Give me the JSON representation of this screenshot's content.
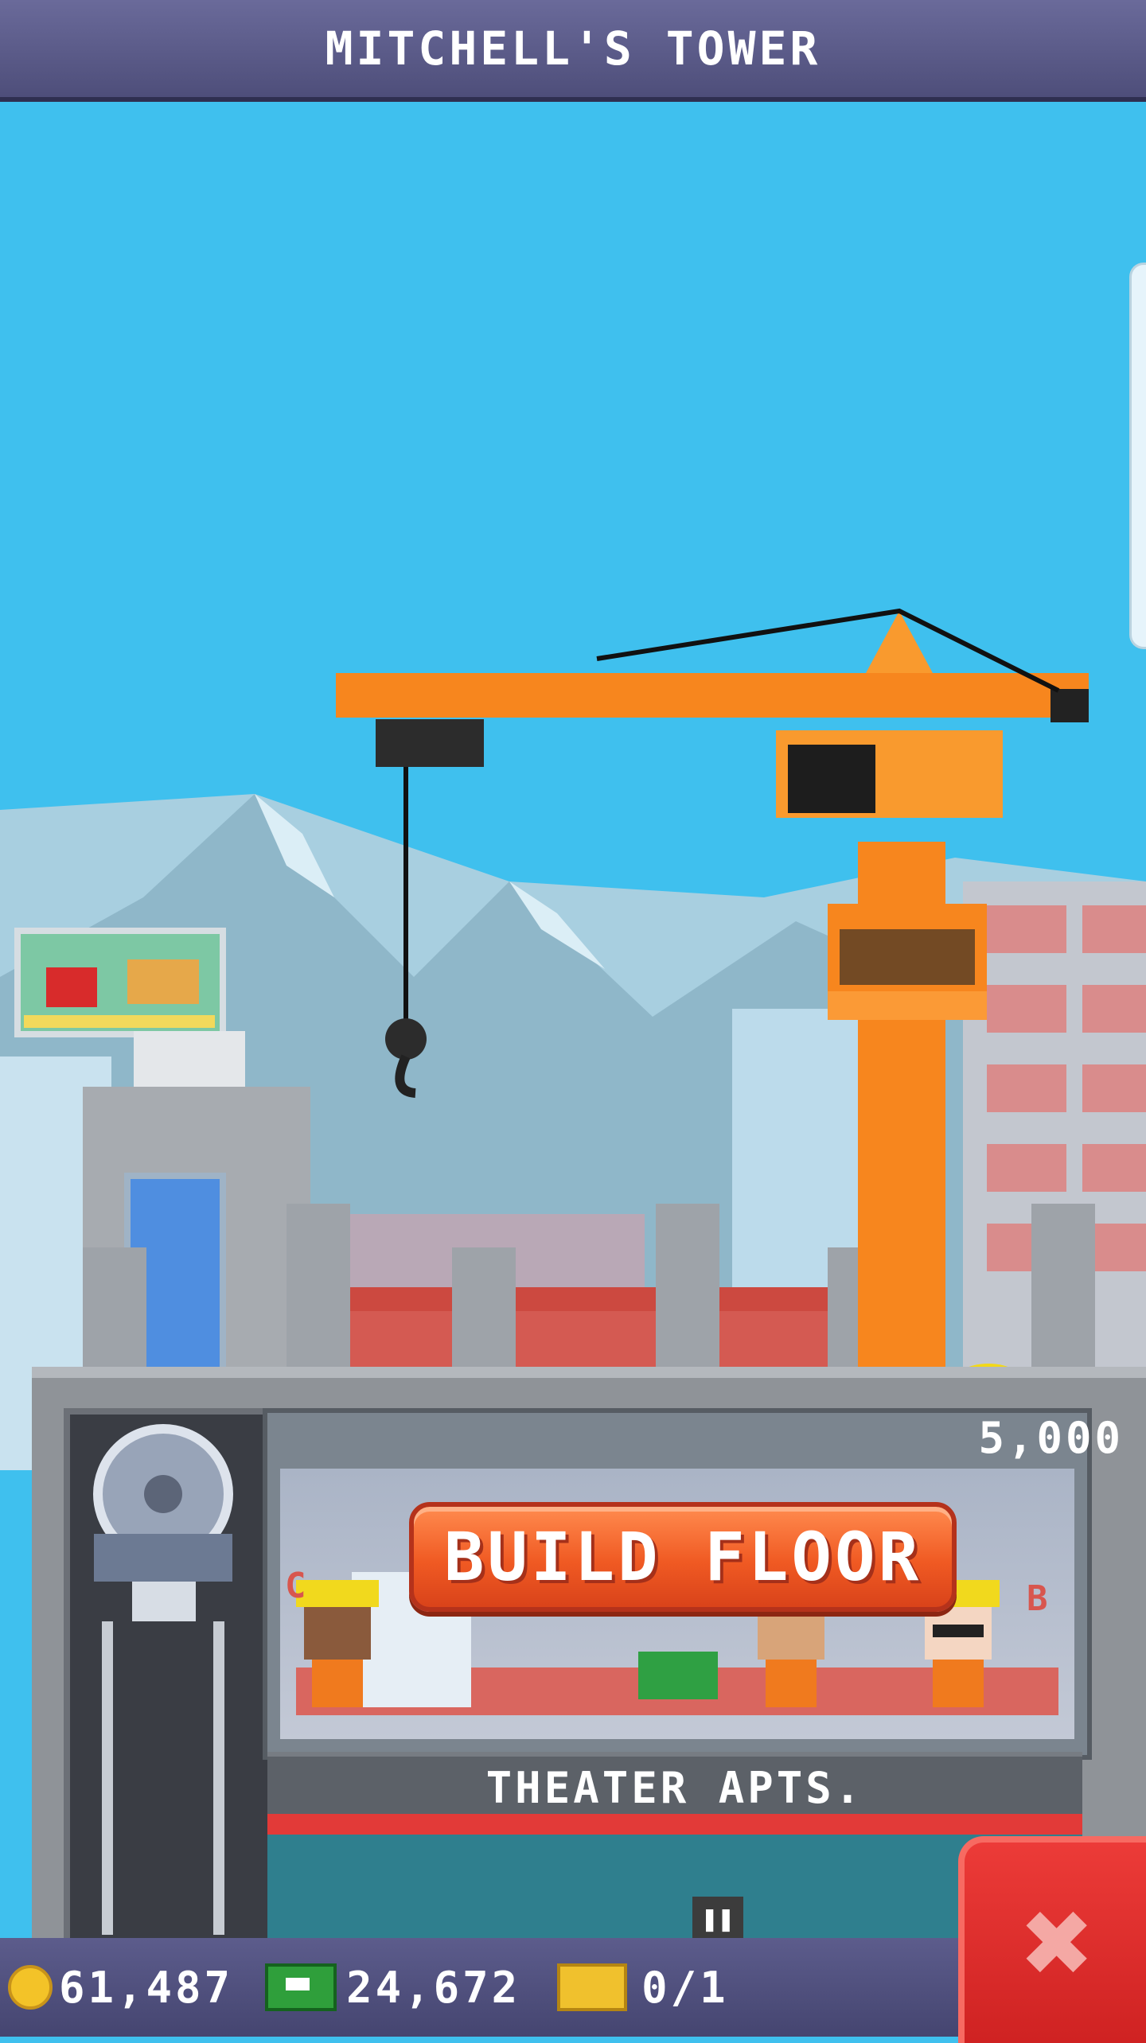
{
  "header": {
    "title": "MITCHELL'S TOWER"
  },
  "floor": {
    "price": "5,000",
    "build_button_label": "BUILD FLOOR",
    "left_label": "C",
    "right_label": "B",
    "floor_name": "THEATER APTS."
  },
  "bottom_bar": {
    "coins": "61,487",
    "cash": "24,672",
    "tickets": "0/1"
  },
  "icons": {
    "coin": "coin-icon",
    "cash": "cash-icon",
    "ticket": "ticket-icon",
    "close": "close-icon",
    "pause": "pause-icon"
  },
  "colors": {
    "sky": "#3fc0ee",
    "header": "#5a5a88",
    "build_button": "#f05a23",
    "close_button": "#d92b2a"
  }
}
